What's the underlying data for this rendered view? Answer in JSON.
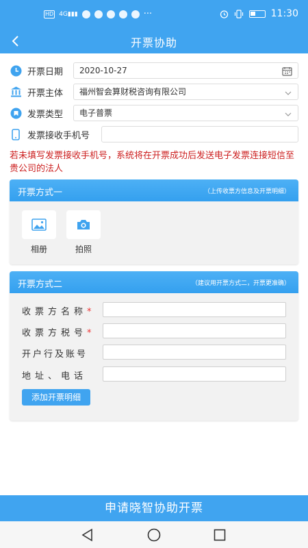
{
  "status_bar": {
    "time": "11:30",
    "ellipsis": "···"
  },
  "nav": {
    "title": "开票协助",
    "back_glyph": "<"
  },
  "form": {
    "date": {
      "label": "开票日期",
      "value": "2020-10-27"
    },
    "entity": {
      "label": "开票主体",
      "value": "福州智会算财税咨询有限公司"
    },
    "invoice_type": {
      "label": "发票类型",
      "value": "电子普票"
    },
    "phone": {
      "label": "发票接收手机号",
      "value": ""
    }
  },
  "notice": "若未填写发票接收手机号，系统将在开票成功后发送电子发票连接短信至贵公司的法人",
  "method_one": {
    "title": "开票方式一",
    "hint": "（上传收票方信息及开票明细）",
    "album_label": "相册",
    "camera_label": "拍照"
  },
  "method_two": {
    "title": "开票方式二",
    "hint": "（建议用开票方式二，开票更准确）",
    "fields": [
      {
        "label": "收票方名称",
        "required": "*"
      },
      {
        "label": "收票方税号",
        "required": "*"
      },
      {
        "label": "开户行及账号",
        "required": ""
      },
      {
        "label": "地址、电话",
        "required": ""
      }
    ],
    "add_button": "添加开票明细"
  },
  "submit_label": "申请晓智协助开票",
  "colors": {
    "primary": "#40a4f0",
    "notice": "#cc1f1f",
    "card_bg": "#f2f2f2"
  },
  "icons": [
    "clock-icon",
    "bank-icon",
    "tag-icon",
    "phone-icon",
    "calendar-icon",
    "chevron-down-icon",
    "image-icon",
    "camera-icon"
  ]
}
